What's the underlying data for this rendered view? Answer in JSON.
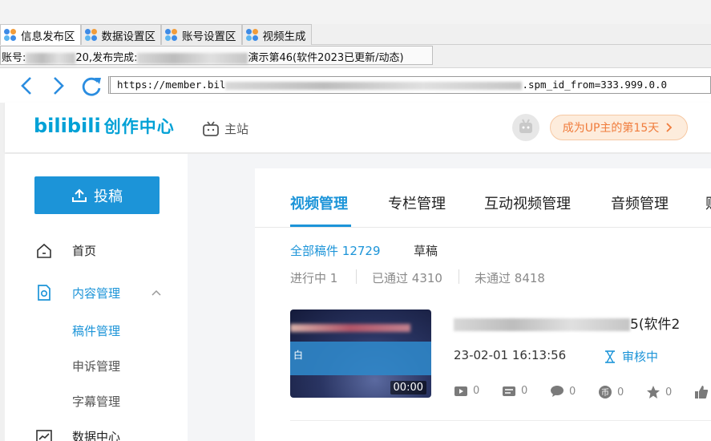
{
  "app_tabs": [
    {
      "label": "信息发布区",
      "active": true
    },
    {
      "label": "数据设置区",
      "active": false
    },
    {
      "label": "账号设置区",
      "active": false
    },
    {
      "label": "视频生成",
      "active": false
    }
  ],
  "status": {
    "account_label": "账号:",
    "account_suffix": "20,发布完成:",
    "publish_suffix": "演示第46(软件2023已更新/动态)"
  },
  "browser": {
    "url_start": "https://member.bil",
    "url_end": ".spm_id_from=333.999.0.0"
  },
  "header": {
    "logo": "bilibili",
    "logo_sub": "创作中心",
    "home_link": "主站",
    "up_badge": "成为UP主的第15天"
  },
  "sidebar": {
    "upload_label": "投稿",
    "items": [
      {
        "label": "首页",
        "icon": "home-icon"
      },
      {
        "label": "内容管理",
        "icon": "content-icon",
        "expanded": true
      },
      {
        "label": "稿件管理",
        "sub": true,
        "active": true
      },
      {
        "label": "申诉管理",
        "sub": true
      },
      {
        "label": "字幕管理",
        "sub": true
      },
      {
        "label": "数据中心",
        "icon": "chart-icon"
      }
    ]
  },
  "content": {
    "tabs": [
      "视频管理",
      "专栏管理",
      "互动视频管理",
      "音频管理",
      "贴"
    ],
    "filters": {
      "all_label": "全部稿件",
      "all_count": "12729",
      "draft": "草稿",
      "in_progress_label": "进行中",
      "in_progress_count": "1",
      "passed_label": "已通过",
      "passed_count": "4310",
      "failed_label": "未通过",
      "failed_count": "8418"
    },
    "video": {
      "title_suffix": "5(软件2",
      "thumb_text": "白",
      "duration": "00:00",
      "time": "23-02-01 16:13:56",
      "status": "审核中",
      "stats": [
        "0",
        "0",
        "0",
        "0",
        "0"
      ]
    }
  },
  "colors": {
    "accent": "#1c94d8",
    "badge_text": "#f07c3c",
    "badge_bg": "#fdecdc"
  }
}
